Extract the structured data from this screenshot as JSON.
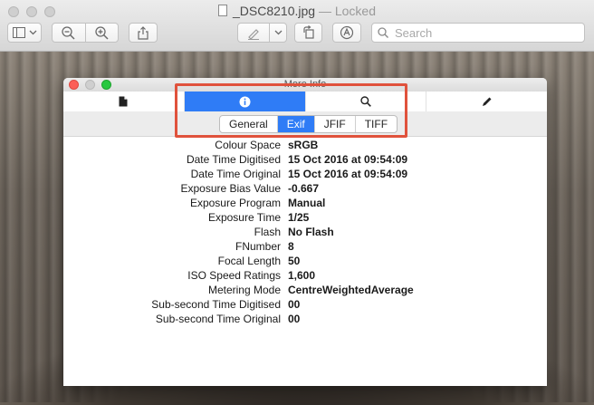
{
  "window": {
    "filename": "_DSC8210.jpg",
    "status": "— Locked"
  },
  "toolbar": {
    "search_placeholder": "Search"
  },
  "panel": {
    "title": "More Info",
    "tabs": [
      {
        "name": "general-tab",
        "icon": "document-icon",
        "active": false
      },
      {
        "name": "info-tab",
        "icon": "info-icon",
        "active": true
      },
      {
        "name": "search-tab",
        "icon": "magnifier-icon",
        "active": false
      },
      {
        "name": "edit-tab",
        "icon": "pencil-icon",
        "active": false
      }
    ],
    "subtabs": [
      "General",
      "Exif",
      "JFIF",
      "TIFF"
    ],
    "active_subtab": "Exif"
  },
  "exif": [
    {
      "label": "Colour Space",
      "value": "sRGB"
    },
    {
      "label": "Date Time Digitised",
      "value": "15 Oct 2016 at 09:54:09"
    },
    {
      "label": "Date Time Original",
      "value": "15 Oct 2016 at 09:54:09"
    },
    {
      "label": "Exposure Bias Value",
      "value": "-0.667"
    },
    {
      "label": "Exposure Program",
      "value": "Manual"
    },
    {
      "label": "Exposure Time",
      "value": "1/25"
    },
    {
      "label": "Flash",
      "value": "No Flash"
    },
    {
      "label": "FNumber",
      "value": "8"
    },
    {
      "label": "Focal Length",
      "value": "50"
    },
    {
      "label": "ISO Speed Ratings",
      "value": "1,600"
    },
    {
      "label": "Metering Mode",
      "value": "CentreWeightedAverage"
    },
    {
      "label": "Sub-second Time Digitised",
      "value": "00"
    },
    {
      "label": "Sub-second Time Original",
      "value": "00"
    }
  ],
  "colors": {
    "accent": "#2f7cf6",
    "highlight": "#e0523c",
    "close": "#fc5f57",
    "minimize": "#fdbc2e",
    "zoom": "#28c840"
  }
}
